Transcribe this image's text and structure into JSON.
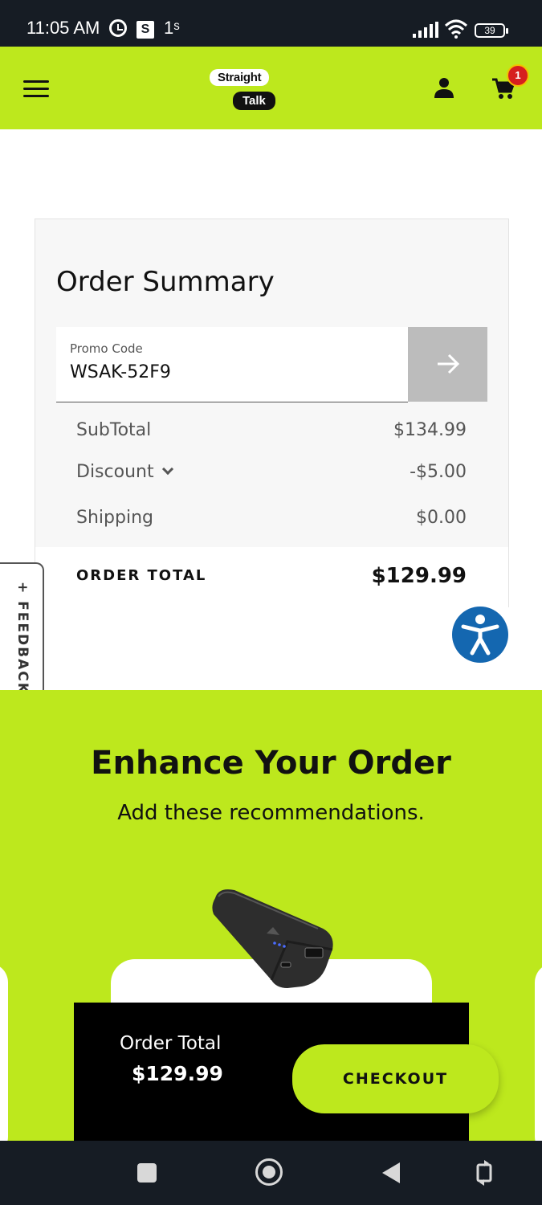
{
  "status_bar": {
    "time": "11:05 AM",
    "s_badge": "S",
    "extra": "1ˢ",
    "battery": "39"
  },
  "header": {
    "logo_top": "Straight",
    "logo_bottom": "Talk",
    "cart_count": "1",
    "icons": [
      "hamburger-menu-icon",
      "user-icon",
      "cart-icon"
    ]
  },
  "order_summary": {
    "title": "Order Summary",
    "promo": {
      "label": "Promo Code",
      "value": "WSAK-52F9"
    },
    "subtotal": {
      "label": "SubTotal",
      "value": "$134.99"
    },
    "discount": {
      "label": "Discount",
      "value": "-$5.00"
    },
    "shipping": {
      "label": "Shipping",
      "value": "$0.00"
    },
    "order_total": {
      "label": "ORDER TOTAL",
      "value": "$129.99"
    }
  },
  "feedback": {
    "label": "+ FEEDBACK"
  },
  "enhance": {
    "title": "Enhance Your Order",
    "subtitle": "Add these recommendations."
  },
  "checkout_bar": {
    "label": "Order Total",
    "value": "$129.99",
    "button": "CHECKOUT"
  },
  "colors": {
    "brand_green": "#bde81d",
    "accessibility_blue": "#1467b0",
    "badge_red": "#d61f1f",
    "dark": "#161c24"
  }
}
